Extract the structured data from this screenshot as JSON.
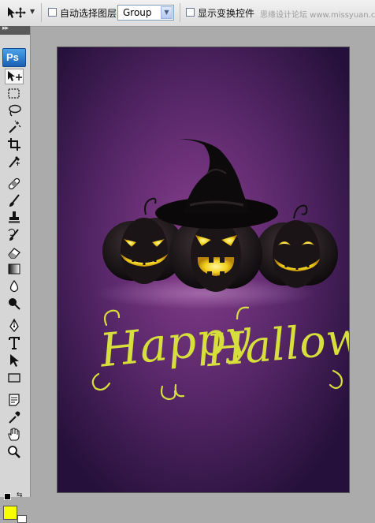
{
  "options_bar": {
    "tool_preset_icon": "move-tool-icon",
    "auto_select_label": "自动选择图层",
    "auto_select_checked": false,
    "auto_select_value": "Group",
    "show_transform_label": "显示变换控件",
    "show_transform_checked": false,
    "watermark": "思缘设计论坛 www.missyuan.com"
  },
  "toolbox": {
    "header": "▸▸",
    "logo": "Ps",
    "tools": [
      "move-tool-icon",
      "marquee-tool-icon",
      "lasso-tool-icon",
      "magic-wand-icon",
      "crop-tool-icon",
      "eyedropper-slice-icon",
      "healing-brush-icon",
      "brush-tool-icon",
      "clone-stamp-icon",
      "history-brush-icon",
      "eraser-icon",
      "gradient-tool-icon",
      "blur-tool-icon",
      "dodge-tool-icon",
      "pen-tool-icon",
      "type-tool-icon",
      "path-selection-icon",
      "rectangle-shape-icon",
      "notes-tool-icon",
      "eyedropper-icon",
      "hand-tool-icon",
      "zoom-tool-icon"
    ],
    "foreground_color": "#f7ff00",
    "background_color": "#ffffff"
  },
  "document": {
    "background_color": "#2e1240",
    "glow_color": "#8a3f8f",
    "text_color": "#d6df3c",
    "word1": "Happy",
    "word2": "Halloween"
  }
}
